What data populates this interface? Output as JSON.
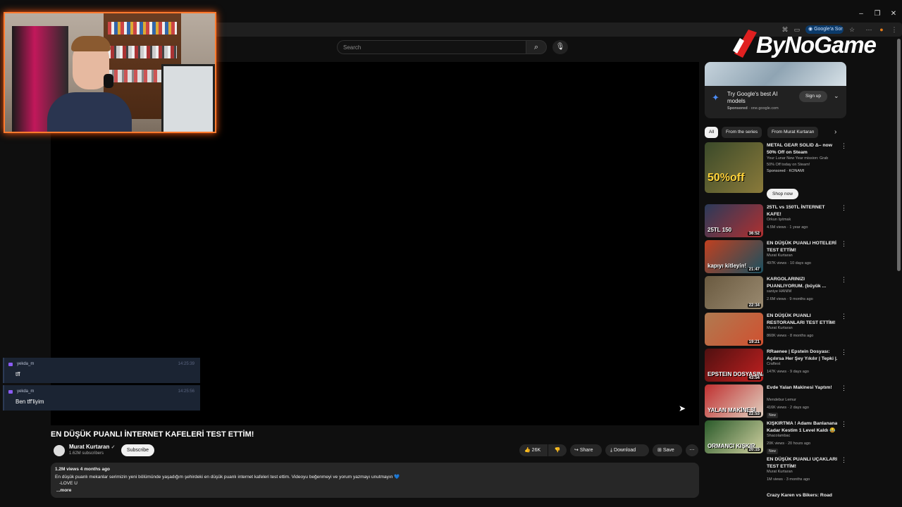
{
  "browser": {
    "lens_label": "Google'a Sor"
  },
  "search": {
    "placeholder": "Search"
  },
  "overlay": {
    "logo": "ByNoGame",
    "chat": [
      {
        "user": "yekda_m",
        "time": "14:25:39",
        "message": "tff"
      },
      {
        "user": "yekda_m",
        "time": "14:25:56",
        "message": "Ben tff'liyim"
      }
    ]
  },
  "video": {
    "title": "EN DÜŞÜK PUANLI İNTERNET KAFELERİ TEST ETTİM!",
    "channel": "Murat Kurtaran",
    "subscribers": "1.62M subscribers",
    "subscribe_label": "Subscribe",
    "likes": "26K",
    "share_label": "Share",
    "download_label": "Download",
    "save_label": "Save",
    "views_date": "1.2M views  4 months ago",
    "description_line1": "En düşük puanlı mekanlar serimizin yeni bölümünde yaşadığım şehirdeki en düşük puanlı internet kafeleri test ettim. Videoyu beğenmeyi ve yorum yazmayı unutmayın 💙",
    "description_line2": "-LOVE U",
    "more_label": "...more"
  },
  "ad": {
    "title": "Try Google's best AI models",
    "sponsored": "Sponsored",
    "domain": "one.google.com",
    "signup_label": "Sign up"
  },
  "chips": [
    "All",
    "From the series",
    "From Murat Kurtaran"
  ],
  "recommendations": [
    {
      "title1": "METAL GEAR SOLID Δ– now",
      "title2": "50% Off on Steam",
      "channel": "Your Lunar New Year mission: Grab",
      "meta": "50% Off today on Steam!",
      "sponsor": "Sponsored · KONAMI",
      "thumb_text": "50%off",
      "shop": "Shop now",
      "colors": [
        "#3b4a2a",
        "#8a7a3a"
      ]
    },
    {
      "title1": "25TL vs 150TL İNTERNET",
      "title2": "KAFE!",
      "channel": "Orkun Işıtmak",
      "meta": "4.5M views · 1 year ago",
      "duration": "36:52",
      "thumb_text": "25TL 150",
      "colors": [
        "#2a3a5a",
        "#b03030"
      ]
    },
    {
      "title1": "EN DÜŞÜK PUANLI HOTELERİ",
      "title2": "TEST ETTİM!",
      "channel": "Murat Kurtaran",
      "meta": "497K views · 10 days ago",
      "duration": "21:47",
      "thumb_text": "kapıyı kitleyin!",
      "colors": [
        "#c04020",
        "#1a5060"
      ]
    },
    {
      "title1": "KARGOLARINIZI",
      "title2": "PUANLIYORUM. (büyük ...",
      "channel": "saniye HANIM",
      "meta": "2.6M views · 9 months ago",
      "duration": "22:34",
      "thumb_text": "",
      "colors": [
        "#6a5a40",
        "#9a8a70"
      ]
    },
    {
      "title1": "EN DÜŞÜK PUANLI",
      "title2": "RESTORANLARI TEST ETTİM!",
      "channel": "Murat Kurtaran",
      "meta": "860K views · 8 months ago",
      "duration": "19:21",
      "thumb_text": "",
      "colors": [
        "#b07a50",
        "#d05030"
      ]
    },
    {
      "title1": "RRaenee | Epstein Dosyası:",
      "title2": "Açılırsa Her Şey Yıkılır | Tepki |...",
      "channel": "Craftest",
      "meta": "147K views · 9 days ago",
      "duration": "43:54",
      "thumb_text": "EPSTEIN DOSYASINA",
      "colors": [
        "#501010",
        "#c02020"
      ]
    },
    {
      "title1": "Evde Yalan Makinesi Yaptım!",
      "title2": "",
      "channel": "Mendebur Lemur",
      "meta": "416K views · 2 days ago",
      "badge": "New",
      "duration": "22:53",
      "thumb_text": "YALAN MAKİNESİ",
      "colors": [
        "#c03030",
        "#e0d0c0"
      ]
    },
    {
      "title1": "KIŞKIRTMA ! Adamı Banlanana",
      "title2": "Kadar Kestim 1 Level Kaldı 😂",
      "channel": "Shacolambac",
      "meta": "20K views · 20 hours ago",
      "badge": "New",
      "duration": "20:15",
      "thumb_text": "ORMANCI KIŞKIR",
      "colors": [
        "#2a5a2a",
        "#d0d0a0"
      ]
    },
    {
      "title1": "EN DÜŞÜK PUANLI UÇAKLARI",
      "title2": "TEST ETTİM!",
      "channel": "Murat Kurtaran",
      "meta": "1M views · 3 months ago",
      "duration": "24:01",
      "thumb_text": "",
      "colors": [
        "#0f0f0f",
        "#0f0f0f"
      ]
    },
    {
      "title1": "Crazy Karen vs Bikers: Road",
      "title2": "",
      "channel": "",
      "meta": "",
      "thumb_text": "",
      "colors": [
        "#0f0f0f",
        "#0f0f0f"
      ]
    }
  ]
}
